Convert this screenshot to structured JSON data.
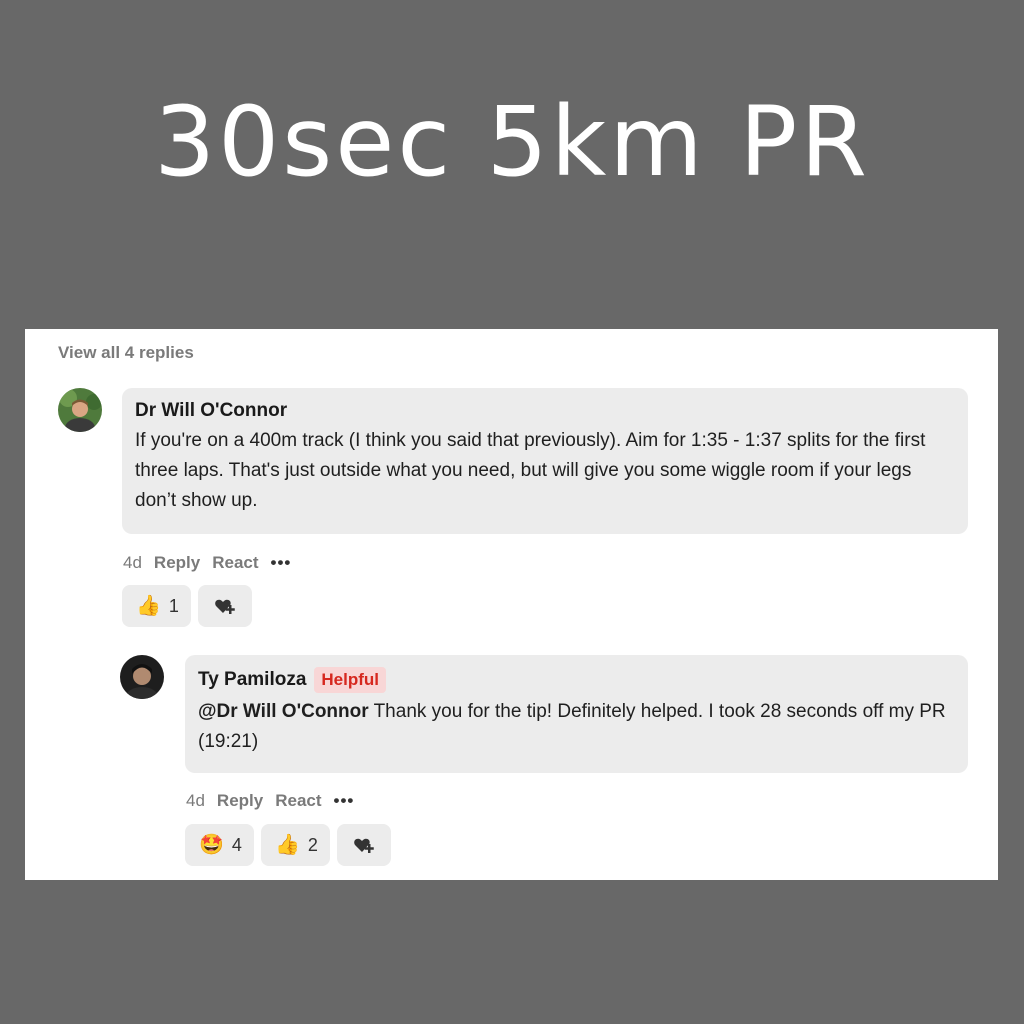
{
  "headline": "30sec 5km PR",
  "thread": {
    "view_all": "View all 4 replies",
    "comments": [
      {
        "author": "Dr Will O'Connor",
        "text": "If you're on a 400m track (I think you said that previously). Aim for 1:35 - 1:37 splits for the first three laps. That's just outside what you need, but will give you some wiggle room if your legs don’t show up.",
        "time": "4d",
        "reply_label": "Reply",
        "react_label": "React",
        "more_label": "•••",
        "reactions": [
          {
            "emoji": "👍",
            "count": "1"
          }
        ]
      },
      {
        "author": "Ty Pamiloza",
        "badge": "Helpful",
        "mention": "@Dr Will O'Connor",
        "text": " Thank you for the tip! Definitely helped. I took 28 seconds off my PR (19:21)",
        "time": "4d",
        "reply_label": "Reply",
        "react_label": "React",
        "more_label": "•••",
        "reactions": [
          {
            "emoji": "🤩",
            "count": "4"
          },
          {
            "emoji": "👍",
            "count": "2"
          }
        ]
      }
    ]
  },
  "colors": {
    "background": "#686868",
    "card": "#ffffff",
    "bubble": "#ececec",
    "badge_text": "#d6281f",
    "badge_bg": "#f8d6d6"
  }
}
